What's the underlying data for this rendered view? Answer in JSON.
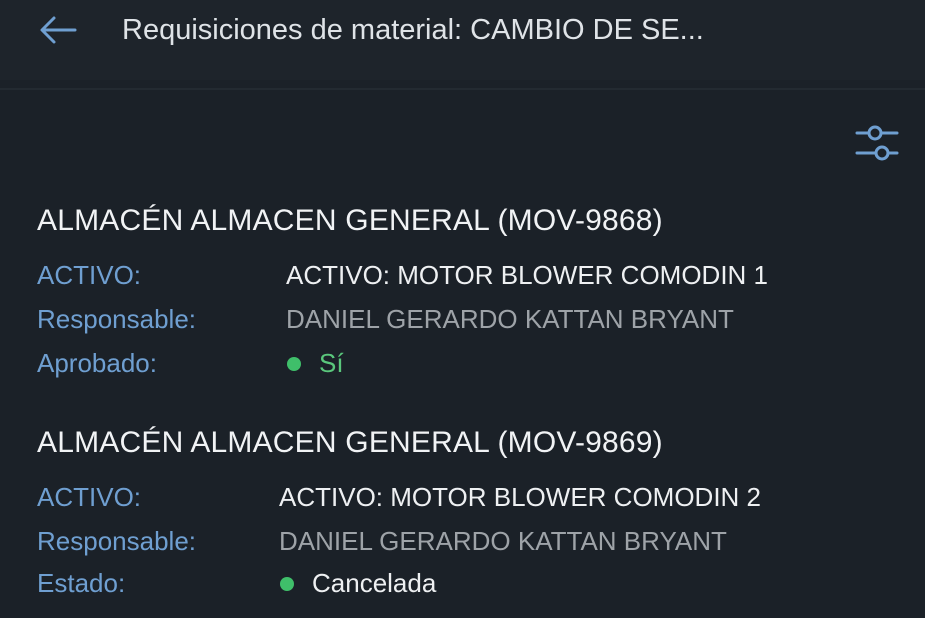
{
  "header": {
    "title": "Requisiciones de material: CAMBIO DE SE..."
  },
  "colors": {
    "background": "#1b2128",
    "accent": "#6f9fd1",
    "status_green": "#3fbf6a"
  },
  "icons": {
    "back": "arrow-left-icon",
    "filter": "sliders-icon"
  },
  "cards": [
    {
      "title": "ALMACÉN ALMACEN GENERAL (MOV-9868)",
      "rows": [
        {
          "label": "ACTIVO:",
          "value": "ACTIVO: MOTOR BLOWER COMODIN 1"
        },
        {
          "label": "Responsable:",
          "value": "DANIEL GERARDO KATTAN BRYANT"
        },
        {
          "label": "Aprobado:",
          "value": "Sí"
        }
      ]
    },
    {
      "title": "ALMACÉN ALMACEN GENERAL (MOV-9869)",
      "rows": [
        {
          "label": "ACTIVO:",
          "value": "ACTIVO: MOTOR BLOWER COMODIN 2"
        },
        {
          "label": "Responsable:",
          "value": "DANIEL GERARDO KATTAN BRYANT"
        },
        {
          "label": "Estado:",
          "value": "Cancelada"
        }
      ]
    }
  ]
}
